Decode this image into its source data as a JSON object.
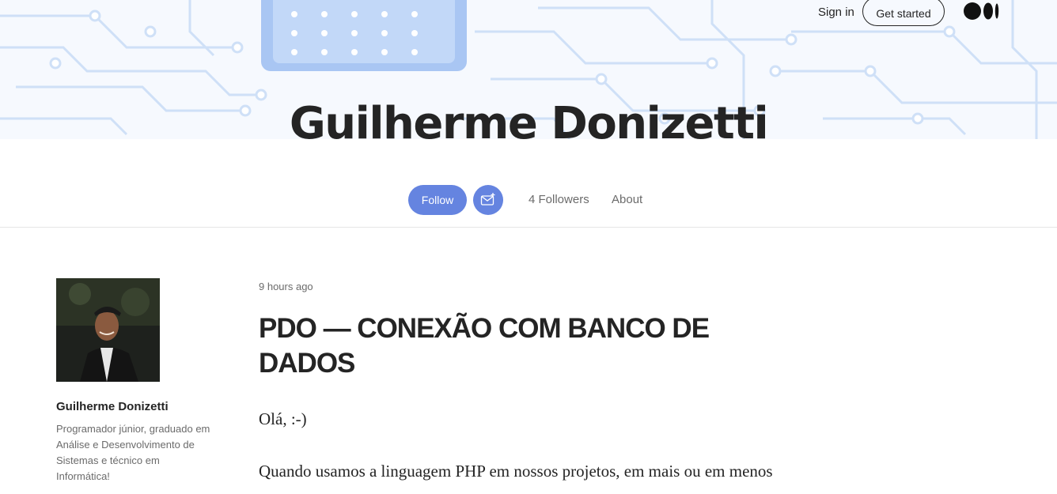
{
  "topnav": {
    "sign_in": "Sign in",
    "get_started": "Get started",
    "logo_icon": "medium-logo-icon"
  },
  "profile": {
    "name": "Guilherme Donizetti",
    "follow_label": "Follow",
    "subscribe_icon": "mail-plus-icon",
    "followers": "4 Followers",
    "about": "About"
  },
  "sidebar": {
    "author_name": "Guilherme Donizetti",
    "bio": "Programador júnior, graduado em Análise e Desenvolvimento de Sistemas e técnico em Informática!"
  },
  "post": {
    "time": "9 hours ago",
    "title": "PDO — CONEXÃO COM BANCO DE DADOS",
    "paragraph1": "Olá, :-)",
    "paragraph2": "Quando usamos a linguagem PHP em nossos projetos, em mais ou em menos"
  },
  "colors": {
    "accent": "#6584e0",
    "text": "#242424",
    "muted": "#6b6b6b",
    "divider": "#e6e6e6"
  }
}
